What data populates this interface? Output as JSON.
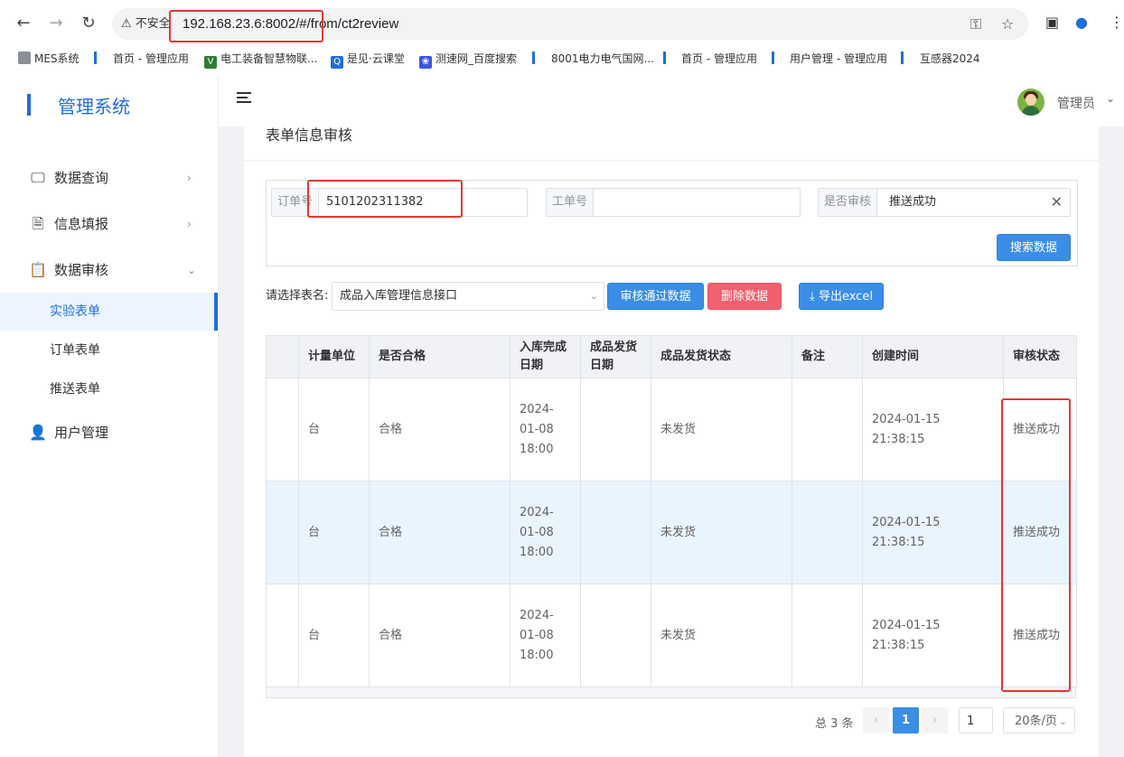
{
  "browser": {
    "insecure_label": "不安全",
    "url": "192.168.23.6:8002/#/from/ct2review",
    "bookmarks": [
      "MES系统",
      "首页 - 管理应用",
      "电工装备智慧物联...",
      "是见·云课堂",
      "测速网_百度搜索",
      "8001电力电气国网...",
      "首页 - 管理应用",
      "用户管理 - 管理应用",
      "互感器2024"
    ]
  },
  "sidebar": {
    "brand": "管理系统",
    "menu": [
      {
        "label": "数据查询",
        "icon": "monitor-icon"
      },
      {
        "label": "信息填报",
        "icon": "document-icon"
      },
      {
        "label": "数据审核",
        "icon": "clipboard-icon"
      }
    ],
    "submenu": [
      "实验表单",
      "订单表单",
      "推送表单"
    ],
    "user_management": "用户管理"
  },
  "header": {
    "user_name": "管理员"
  },
  "page": {
    "title": "表单信息审核",
    "filters": {
      "order_label": "订单号",
      "order_value": "5101202311382",
      "work_label": "工单号",
      "work_value": "",
      "review_label": "是否审核",
      "review_value": "推送成功"
    },
    "search_button": "搜索数据",
    "table_select_label": "请选择表名:",
    "table_select_value": "成品入库管理信息接口",
    "approve_button": "审核通过数据",
    "delete_button": "删除数据",
    "export_button": "导出excel"
  },
  "table": {
    "headers": [
      "",
      "计量单位",
      "是否合格",
      "入库完成日期",
      "成品发货日期",
      "成品发货状态",
      "备注",
      "创建时间",
      "审核状态"
    ],
    "rows": [
      {
        "unit": "台",
        "qualified": "合格",
        "stock_date": "2024-01-08 18:00",
        "ship_date": "",
        "ship_status": "未发货",
        "note": "",
        "created": "2024-01-15 21:38:15",
        "review": "推送成功"
      },
      {
        "unit": "台",
        "qualified": "合格",
        "stock_date": "2024-01-08 18:00",
        "ship_date": "",
        "ship_status": "未发货",
        "note": "",
        "created": "2024-01-15 21:38:15",
        "review": "推送成功"
      },
      {
        "unit": "台",
        "qualified": "合格",
        "stock_date": "2024-01-08 18:00",
        "ship_date": "",
        "ship_status": "未发货",
        "note": "",
        "created": "2024-01-15 21:38:15",
        "review": "推送成功"
      }
    ]
  },
  "pagination": {
    "total": "总 3 条",
    "current": "1",
    "jump": "1",
    "page_size": "20条/页"
  }
}
